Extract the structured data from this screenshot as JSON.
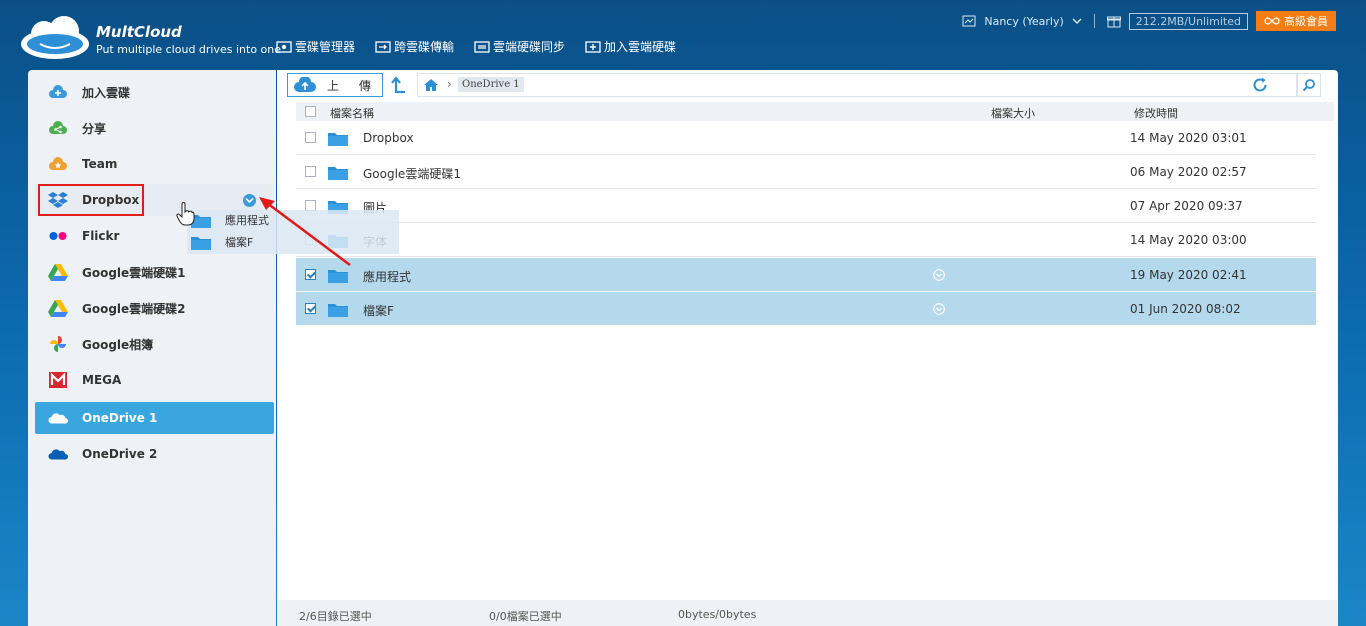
{
  "brand": {
    "name": "MultCloud",
    "tagline": "Put multiple cloud drives into one"
  },
  "topnav": [
    {
      "label": "雲碟管理器",
      "icon": "cloud-manager-icon"
    },
    {
      "label": "跨雲碟傳輸",
      "icon": "cloud-transfer-icon"
    },
    {
      "label": "雲端硬碟同步",
      "icon": "cloud-sync-icon"
    },
    {
      "label": "加入雲端硬碟",
      "icon": "add-cloud-icon"
    }
  ],
  "user": {
    "name": "Nancy (Yearly)",
    "storage": "212.2MB/Unlimited",
    "premium_label": "高級會員"
  },
  "sidebar": {
    "items": [
      {
        "label": "加入雲碟",
        "icon": "add-cloud-icon",
        "color": "#3b9ad9"
      },
      {
        "label": "分享",
        "icon": "share-icon",
        "color": "#4caf50"
      },
      {
        "label": "Team",
        "icon": "team-icon",
        "color": "#f0a030"
      },
      {
        "label": "Dropbox",
        "icon": "dropbox-icon",
        "color": "#0061fe"
      },
      {
        "label": "Flickr",
        "icon": "flickr-icon",
        "color": "#ff0084"
      },
      {
        "label": "Google雲端硬碟1",
        "icon": "google-drive-icon",
        "color": "#34a853"
      },
      {
        "label": "Google雲端硬碟2",
        "icon": "google-drive-icon",
        "color": "#34a853"
      },
      {
        "label": "Google相簿",
        "icon": "google-photos-icon",
        "color": "#fbbc05"
      },
      {
        "label": "MEGA",
        "icon": "mega-icon",
        "color": "#d9272e"
      },
      {
        "label": "OneDrive 1",
        "icon": "onedrive-icon",
        "color": "#ffffff"
      },
      {
        "label": "OneDrive 2",
        "icon": "onedrive-icon",
        "color": "#0a5fb4"
      }
    ]
  },
  "toolbar": {
    "upload_label": "上 傳",
    "breadcrumb": "OneDrive 1"
  },
  "columns": {
    "name": "檔案名稱",
    "size": "檔案大小",
    "modified": "修改時間"
  },
  "files": [
    {
      "name": "Dropbox",
      "modified": "14 May 2020 03:01",
      "selected": false
    },
    {
      "name": "Google雲端硬碟1",
      "modified": "06 May 2020 02:57",
      "selected": false
    },
    {
      "name": "圖片",
      "modified": "07 Apr 2020 09:37",
      "selected": false
    },
    {
      "name": "字体",
      "modified": "14 May 2020 03:00",
      "selected": false
    },
    {
      "name": "應用程式",
      "modified": "19 May 2020 02:41",
      "selected": true
    },
    {
      "name": "檔案F",
      "modified": "01 Jun 2020 08:02",
      "selected": true
    }
  ],
  "drag_preview": {
    "items": [
      "應用程式",
      "檔案F"
    ]
  },
  "status": {
    "folders": "2/6目錄已選中",
    "files": "0/0檔案已選中",
    "bytes": "0bytes/0bytes"
  },
  "colors": {
    "accent": "#3aa6e0",
    "selected_row": "#b4d8ec",
    "premium": "#f47d15",
    "highlight": "#e21a1a"
  }
}
